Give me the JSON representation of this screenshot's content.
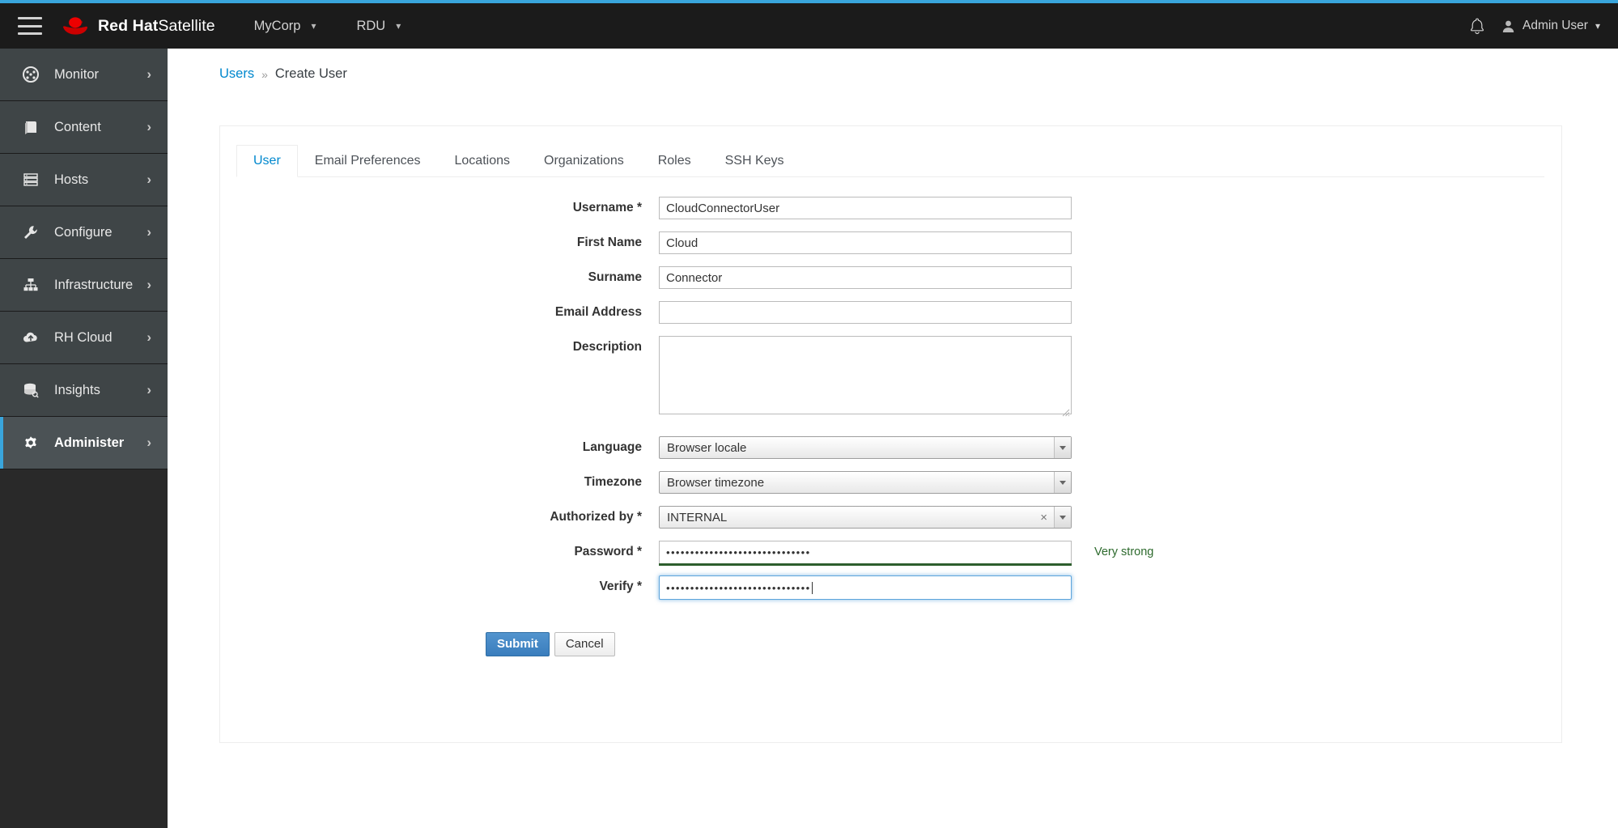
{
  "theme": {
    "accent_blue": "#39a5dc",
    "link_blue": "#0088ce",
    "masthead_bg": "#1b1b1b",
    "sidebar_item_bg": "#3f4547",
    "sidebar_active_bg": "#4b5255",
    "strength_green": "#2d6a2d",
    "primary_button_blue": "#3a7dbd"
  },
  "masthead": {
    "menu_icon": "hamburger-icon",
    "brand_bold": "Red Hat",
    "brand_light": "Satellite",
    "brand_logo_icon": "red-hat-fedora-logo",
    "org_label": "MyCorp",
    "location_label": "RDU",
    "chevron": "⌄",
    "notifications_icon": "bell-icon",
    "user_icon": "user-avatar-icon",
    "user_label": "Admin User"
  },
  "sidebar": {
    "items": [
      {
        "label": "Monitor",
        "icon": "dashboard-icon",
        "arrow": "›",
        "active": false
      },
      {
        "label": "Content",
        "icon": "book-icon",
        "arrow": "›",
        "active": false
      },
      {
        "label": "Hosts",
        "icon": "server-stack-icon",
        "arrow": "›",
        "active": false
      },
      {
        "label": "Configure",
        "icon": "wrench-icon",
        "arrow": "›",
        "active": false
      },
      {
        "label": "Infrastructure",
        "icon": "sitemap-icon",
        "arrow": "›",
        "active": false
      },
      {
        "label": "RH Cloud",
        "icon": "cloud-upload-icon",
        "arrow": "›",
        "active": false
      },
      {
        "label": "Insights",
        "icon": "database-search-icon",
        "arrow": "›",
        "active": false
      },
      {
        "label": "Administer",
        "icon": "gear-icon",
        "arrow": "›",
        "active": true
      }
    ]
  },
  "breadcrumb": {
    "parent": "Users",
    "separator": "»",
    "current": "Create User"
  },
  "tabs": [
    {
      "label": "User",
      "active": true
    },
    {
      "label": "Email Preferences",
      "active": false
    },
    {
      "label": "Locations",
      "active": false
    },
    {
      "label": "Organizations",
      "active": false
    },
    {
      "label": "Roles",
      "active": false
    },
    {
      "label": "SSH Keys",
      "active": false
    }
  ],
  "form": {
    "username": {
      "label": "Username *",
      "value": "CloudConnectorUser",
      "placeholder": ""
    },
    "first_name": {
      "label": "First Name",
      "value": "Cloud",
      "placeholder": ""
    },
    "surname": {
      "label": "Surname",
      "value": "Connector",
      "placeholder": ""
    },
    "email": {
      "label": "Email Address",
      "value": "",
      "placeholder": ""
    },
    "description": {
      "label": "Description",
      "value": "",
      "placeholder": ""
    },
    "language": {
      "label": "Language",
      "value": "Browser locale"
    },
    "timezone": {
      "label": "Timezone",
      "value": "Browser timezone"
    },
    "authorized_by": {
      "label": "Authorized by *",
      "value": "INTERNAL",
      "clear_icon": "×"
    },
    "password": {
      "label": "Password *",
      "value": "••••••••••••••••••••••••••••••",
      "strength_text": "Very strong"
    },
    "verify": {
      "label": "Verify *",
      "value": "••••••••••••••••••••••••••••••"
    }
  },
  "actions": {
    "submit_label": "Submit",
    "cancel_label": "Cancel"
  }
}
